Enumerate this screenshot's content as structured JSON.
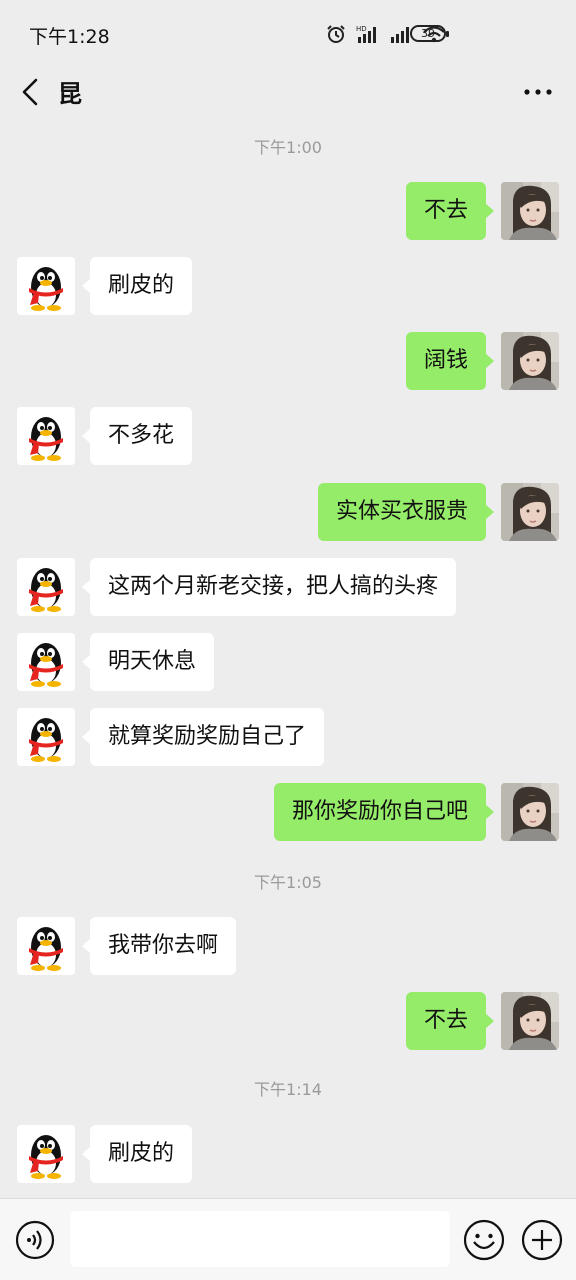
{
  "status_bar": {
    "time": "下午1:28",
    "battery": "39",
    "icons": [
      "alarm-icon",
      "hd-signal-icon",
      "signal-icon",
      "wifi-icon",
      "battery-icon"
    ]
  },
  "header": {
    "title": "昆",
    "back_icon": "back-chevron-icon",
    "more_icon": "more-dots-icon"
  },
  "messages": [
    {
      "type": "time",
      "text": "下午1:00"
    },
    {
      "type": "msg",
      "side": "right",
      "text": "不去"
    },
    {
      "type": "msg",
      "side": "left",
      "text": "刷皮的"
    },
    {
      "type": "msg",
      "side": "right",
      "text": "阔钱"
    },
    {
      "type": "msg",
      "side": "left",
      "text": "不多花"
    },
    {
      "type": "msg",
      "side": "right",
      "text": "实体买衣服贵"
    },
    {
      "type": "msg",
      "side": "left",
      "text": "这两个月新老交接，把人搞的头疼"
    },
    {
      "type": "msg",
      "side": "left",
      "text": "明天休息"
    },
    {
      "type": "msg",
      "side": "left",
      "text": "就算奖励奖励自己了"
    },
    {
      "type": "msg",
      "side": "right",
      "text": "那你奖励你自己吧"
    },
    {
      "type": "time",
      "text": "下午1:05"
    },
    {
      "type": "msg",
      "side": "left",
      "text": "我带你去啊"
    },
    {
      "type": "msg",
      "side": "right",
      "text": "不去"
    },
    {
      "type": "time",
      "text": "下午1:14"
    },
    {
      "type": "msg",
      "side": "left",
      "text": "刷皮的"
    }
  ],
  "input_bar": {
    "voice_icon": "voice-icon",
    "text_value": "",
    "emoji_icon": "emoji-icon",
    "plus_icon": "plus-icon"
  },
  "colors": {
    "background": "#ededed",
    "sent_bubble": "#95ec69",
    "received_bubble": "#ffffff",
    "timestamp": "#9a9a9a"
  }
}
